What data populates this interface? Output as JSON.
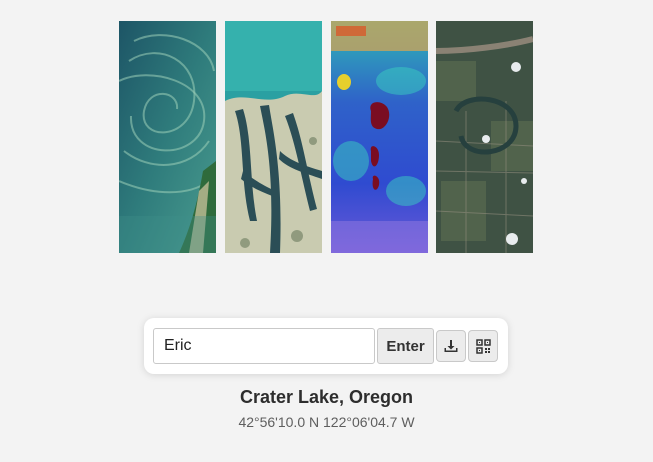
{
  "gallery": {
    "tiles": [
      {
        "subject": "coastal plankton swirl",
        "colors": [
          "#1f5a6a",
          "#3b8b86",
          "#9fc9b6"
        ]
      },
      {
        "subject": "tidal delta channels",
        "colors": [
          "#2f9ea0",
          "#2c4f55",
          "#c5c8ad"
        ]
      },
      {
        "subject": "false-color lakes",
        "colors": [
          "#2d43c8",
          "#31c9c0",
          "#8a0f2a"
        ]
      },
      {
        "subject": "river oxbow fields",
        "colors": [
          "#3b4c3f",
          "#55664f",
          "#8f887a"
        ]
      }
    ]
  },
  "form": {
    "input_value": "Eric",
    "enter_label": "Enter",
    "download_icon": "download-icon",
    "qr_icon": "qr-code-icon"
  },
  "location": {
    "name": "Crater Lake, Oregon",
    "coordinates": "42°56'10.0 N 122°06'04.7 W"
  },
  "colors": {
    "background": "#f3f3f3",
    "panel": "#ffffff",
    "button": "#ececec",
    "border": "#c9c9c9"
  }
}
